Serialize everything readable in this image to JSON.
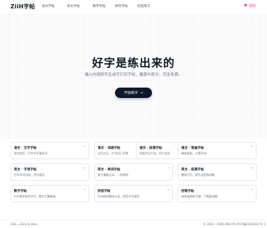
{
  "nav": {
    "logo": "ZiiH字帖",
    "items": [
      {
        "label": "语文字帖",
        "has_menu": true
      },
      {
        "label": "英文字帖",
        "has_menu": true
      },
      {
        "label": "数字字帖",
        "has_menu": false
      },
      {
        "label": "拼音字帖",
        "has_menu": false
      },
      {
        "label": "控笔练习",
        "has_menu": false
      }
    ],
    "donate_label": "捐助",
    "donate_icon": "heart-icon"
  },
  "hero": {
    "title": "好字是练出来的",
    "subtitle": "输入内容即可生成可打印字帖，覆盖中英文，完全免费。",
    "cta_label": "开始练字",
    "cta_icon": "arrow-right-icon"
  },
  "cards": [
    {
      "title": "语文 · 汉字字帖",
      "desc": "逐字描写，打牢书写基本功"
    },
    {
      "title": "语文 · 词语字帖",
      "desc": "边写边记，扩充词汇积累"
    },
    {
      "title": "语文 · 段落字帖",
      "desc": "积跬步至千里，积少成多"
    },
    {
      "title": "语文 · 笔画字帖",
      "desc": "精准笔画，从零开始"
    },
    {
      "title": "英文 · 字母字帖",
      "desc": "打牢字母功底，字形规范"
    },
    {
      "title": "英文 · 单词字帖",
      "desc": "练手兼顾记词，一举两得"
    },
    {
      "title": "英文 · 段落字帖",
      "desc": "整段书写，提升连贯和流畅"
    },
    {
      "title": "数字字帖",
      "desc": "0-9 数字规范书写，数字工整美观"
    },
    {
      "title": "拼音字帖",
      "desc": "声母韵母整体认读，拼音书写规范"
    },
    {
      "title": "控笔字帖",
      "desc": "线条曲线练手感，下笔更流畅"
    }
  ],
  "footer": {
    "left": "ZiiH = Zero to Hero",
    "right": "© 2023 - 2026  ZIIH.CN  沪ICP备2023042?号-1"
  },
  "colors": {
    "accent_dark": "#0f172a",
    "donate_pink": "#ec4899"
  }
}
